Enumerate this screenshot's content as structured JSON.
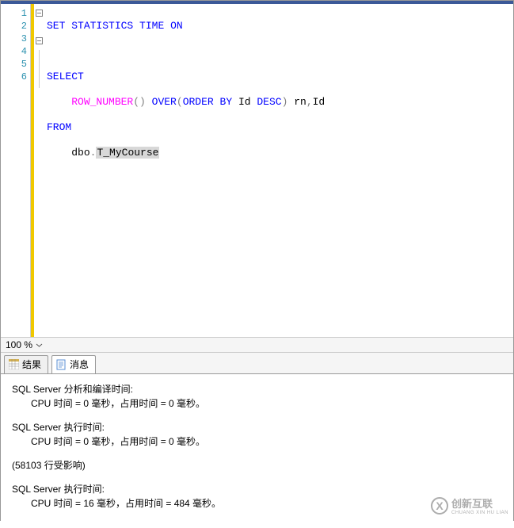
{
  "editor": {
    "line_numbers": [
      "1",
      "2",
      "3",
      "4",
      "5",
      "6"
    ],
    "code": {
      "l1": {
        "kw_set": "SET",
        "kw_stat": "STATISTICS",
        "kw_time": "TIME",
        "kw_on": "ON"
      },
      "l3": {
        "kw_select": "SELECT"
      },
      "l4": {
        "fn_rownum": "ROW_NUMBER",
        "op_open": "()",
        "kw_over": "OVER",
        "op_paren_open": "(",
        "kw_order": "ORDER",
        "kw_by": "BY",
        "id_col": "Id",
        "kw_desc": "DESC",
        "op_paren_close": ")",
        "alias": "rn",
        "comma": ",",
        "id_col2": "Id"
      },
      "l5": {
        "kw_from": "FROM"
      },
      "l6": {
        "schema": "dbo",
        "dot": ".",
        "table": "T_MyCourse"
      }
    }
  },
  "zoom": {
    "level": "100 %"
  },
  "tabs": {
    "results": "结果",
    "messages": "消息"
  },
  "output": {
    "parse_header": "SQL Server 分析和编译时间:",
    "parse_line": "CPU 时间 = 0 毫秒，占用时间 = 0 毫秒。",
    "exec1_header": "SQL Server 执行时间:",
    "exec1_line": "CPU 时间 = 0 毫秒，占用时间 = 0 毫秒。",
    "rows_affected": "(58103 行受影响)",
    "exec2_header": "SQL Server 执行时间:",
    "exec2_line": "CPU 时间 = 16 毫秒，占用时间 = 484 毫秒。"
  },
  "watermark": {
    "brand": "创新互联",
    "sub": "CHUANG XIN HU LIAN",
    "mark": "X"
  }
}
